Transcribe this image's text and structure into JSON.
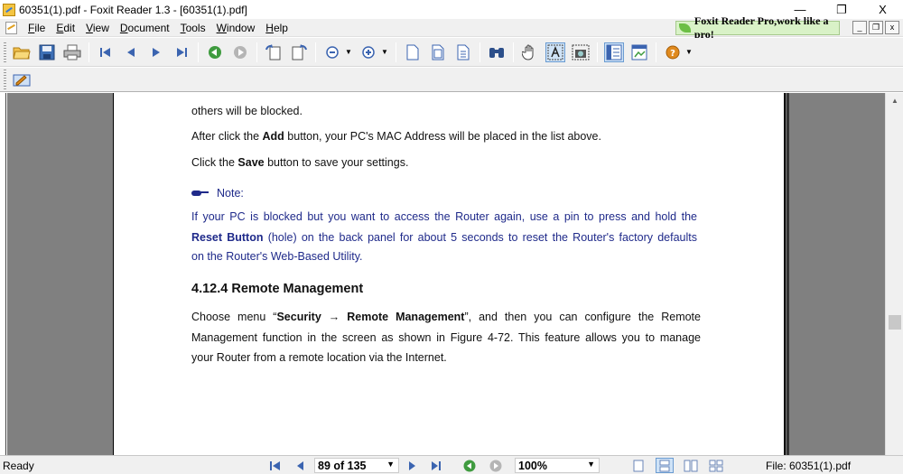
{
  "window": {
    "title": "60351(1).pdf - Foxit Reader 1.3 - [60351(1).pdf]",
    "controls": {
      "minimize": "—",
      "restore": "❐",
      "close": "X"
    }
  },
  "menu": {
    "items": [
      "File",
      "Edit",
      "View",
      "Document",
      "Tools",
      "Window",
      "Help"
    ],
    "promo": "Foxit Reader Pro,work like a pro!",
    "mdi": {
      "minimize": "_",
      "restore": "❐",
      "close": "x"
    }
  },
  "toolbar": {
    "icons": [
      "open-icon",
      "save-icon",
      "print-icon",
      "first-page-icon",
      "previous-page-icon",
      "next-page-icon",
      "last-page-icon",
      "go-back-icon",
      "go-forward-icon",
      "rotate-left-icon",
      "rotate-right-icon",
      "zoom-out-icon",
      "zoom-in-icon",
      "single-page-icon",
      "continuous-icon",
      "facing-icon",
      "find-icon",
      "hand-tool-icon",
      "text-select-icon",
      "snapshot-icon",
      "bookmarks-icon",
      "thumbnails-icon",
      "help-icon"
    ],
    "active": [
      "text-select-icon",
      "bookmarks-icon"
    ]
  },
  "document": {
    "line_partial": "others will be blocked.",
    "line_add": {
      "pre": "After click the ",
      "bold": "Add",
      "post": " button, your PC's MAC Address will be placed in the list above."
    },
    "line_save": {
      "pre": "Click the ",
      "bold": "Save",
      "post": " button to save your settings."
    },
    "note_label": "Note:",
    "note_line1": "If your PC is blocked but you want to access the Router again, use a pin to press and hold the",
    "note_line2": {
      "bold": "Reset Button",
      "post": " (hole) on the back panel for about 5 seconds to reset the Router's factory defaults"
    },
    "note_line3": "on the Router's Web-Based Utility.",
    "section_heading": "4.12.4  Remote Management",
    "para_line1": {
      "pre": "Choose menu “",
      "bold": "Security → Remote Management",
      "post": "”, and then you can configure the Remote"
    },
    "para_line2": "Management function in the screen as shown in Figure 4-72. This feature allows you to manage",
    "para_line3": "your Router from a remote location via the Internet."
  },
  "status": {
    "ready": "Ready",
    "page": "89 of 135",
    "zoom": "100%",
    "file": "File: 60351(1).pdf"
  },
  "colors": {
    "note_text": "#1f2a8a",
    "canvas_gray": "#808080",
    "promo_bg": "#d9f2c7"
  }
}
